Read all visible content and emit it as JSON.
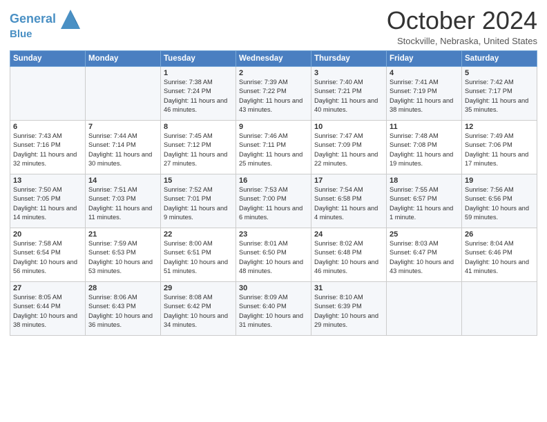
{
  "header": {
    "logo_line1": "General",
    "logo_line2": "Blue",
    "month": "October 2024",
    "location": "Stockville, Nebraska, United States"
  },
  "days_of_week": [
    "Sunday",
    "Monday",
    "Tuesday",
    "Wednesday",
    "Thursday",
    "Friday",
    "Saturday"
  ],
  "weeks": [
    [
      {
        "day": "",
        "detail": ""
      },
      {
        "day": "",
        "detail": ""
      },
      {
        "day": "1",
        "detail": "Sunrise: 7:38 AM\nSunset: 7:24 PM\nDaylight: 11 hours\nand 46 minutes."
      },
      {
        "day": "2",
        "detail": "Sunrise: 7:39 AM\nSunset: 7:22 PM\nDaylight: 11 hours\nand 43 minutes."
      },
      {
        "day": "3",
        "detail": "Sunrise: 7:40 AM\nSunset: 7:21 PM\nDaylight: 11 hours\nand 40 minutes."
      },
      {
        "day": "4",
        "detail": "Sunrise: 7:41 AM\nSunset: 7:19 PM\nDaylight: 11 hours\nand 38 minutes."
      },
      {
        "day": "5",
        "detail": "Sunrise: 7:42 AM\nSunset: 7:17 PM\nDaylight: 11 hours\nand 35 minutes."
      }
    ],
    [
      {
        "day": "6",
        "detail": "Sunrise: 7:43 AM\nSunset: 7:16 PM\nDaylight: 11 hours\nand 32 minutes."
      },
      {
        "day": "7",
        "detail": "Sunrise: 7:44 AM\nSunset: 7:14 PM\nDaylight: 11 hours\nand 30 minutes."
      },
      {
        "day": "8",
        "detail": "Sunrise: 7:45 AM\nSunset: 7:12 PM\nDaylight: 11 hours\nand 27 minutes."
      },
      {
        "day": "9",
        "detail": "Sunrise: 7:46 AM\nSunset: 7:11 PM\nDaylight: 11 hours\nand 25 minutes."
      },
      {
        "day": "10",
        "detail": "Sunrise: 7:47 AM\nSunset: 7:09 PM\nDaylight: 11 hours\nand 22 minutes."
      },
      {
        "day": "11",
        "detail": "Sunrise: 7:48 AM\nSunset: 7:08 PM\nDaylight: 11 hours\nand 19 minutes."
      },
      {
        "day": "12",
        "detail": "Sunrise: 7:49 AM\nSunset: 7:06 PM\nDaylight: 11 hours\nand 17 minutes."
      }
    ],
    [
      {
        "day": "13",
        "detail": "Sunrise: 7:50 AM\nSunset: 7:05 PM\nDaylight: 11 hours\nand 14 minutes."
      },
      {
        "day": "14",
        "detail": "Sunrise: 7:51 AM\nSunset: 7:03 PM\nDaylight: 11 hours\nand 11 minutes."
      },
      {
        "day": "15",
        "detail": "Sunrise: 7:52 AM\nSunset: 7:01 PM\nDaylight: 11 hours\nand 9 minutes."
      },
      {
        "day": "16",
        "detail": "Sunrise: 7:53 AM\nSunset: 7:00 PM\nDaylight: 11 hours\nand 6 minutes."
      },
      {
        "day": "17",
        "detail": "Sunrise: 7:54 AM\nSunset: 6:58 PM\nDaylight: 11 hours\nand 4 minutes."
      },
      {
        "day": "18",
        "detail": "Sunrise: 7:55 AM\nSunset: 6:57 PM\nDaylight: 11 hours\nand 1 minute."
      },
      {
        "day": "19",
        "detail": "Sunrise: 7:56 AM\nSunset: 6:56 PM\nDaylight: 10 hours\nand 59 minutes."
      }
    ],
    [
      {
        "day": "20",
        "detail": "Sunrise: 7:58 AM\nSunset: 6:54 PM\nDaylight: 10 hours\nand 56 minutes."
      },
      {
        "day": "21",
        "detail": "Sunrise: 7:59 AM\nSunset: 6:53 PM\nDaylight: 10 hours\nand 53 minutes."
      },
      {
        "day": "22",
        "detail": "Sunrise: 8:00 AM\nSunset: 6:51 PM\nDaylight: 10 hours\nand 51 minutes."
      },
      {
        "day": "23",
        "detail": "Sunrise: 8:01 AM\nSunset: 6:50 PM\nDaylight: 10 hours\nand 48 minutes."
      },
      {
        "day": "24",
        "detail": "Sunrise: 8:02 AM\nSunset: 6:48 PM\nDaylight: 10 hours\nand 46 minutes."
      },
      {
        "day": "25",
        "detail": "Sunrise: 8:03 AM\nSunset: 6:47 PM\nDaylight: 10 hours\nand 43 minutes."
      },
      {
        "day": "26",
        "detail": "Sunrise: 8:04 AM\nSunset: 6:46 PM\nDaylight: 10 hours\nand 41 minutes."
      }
    ],
    [
      {
        "day": "27",
        "detail": "Sunrise: 8:05 AM\nSunset: 6:44 PM\nDaylight: 10 hours\nand 38 minutes."
      },
      {
        "day": "28",
        "detail": "Sunrise: 8:06 AM\nSunset: 6:43 PM\nDaylight: 10 hours\nand 36 minutes."
      },
      {
        "day": "29",
        "detail": "Sunrise: 8:08 AM\nSunset: 6:42 PM\nDaylight: 10 hours\nand 34 minutes."
      },
      {
        "day": "30",
        "detail": "Sunrise: 8:09 AM\nSunset: 6:40 PM\nDaylight: 10 hours\nand 31 minutes."
      },
      {
        "day": "31",
        "detail": "Sunrise: 8:10 AM\nSunset: 6:39 PM\nDaylight: 10 hours\nand 29 minutes."
      },
      {
        "day": "",
        "detail": ""
      },
      {
        "day": "",
        "detail": ""
      }
    ]
  ]
}
